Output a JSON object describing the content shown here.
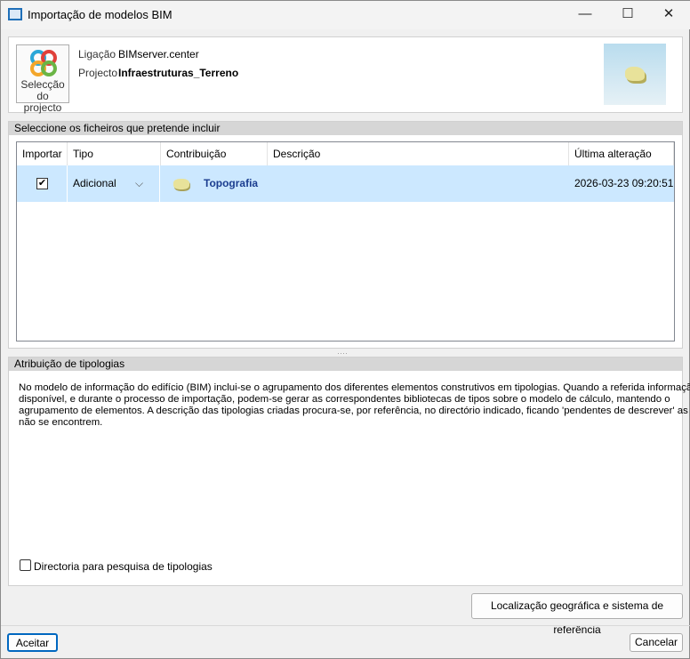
{
  "window": {
    "title": "Importação de modelos BIM",
    "minimize": "—",
    "maximize": "☐",
    "close": "✕"
  },
  "project": {
    "select_button": "Selecção do projecto",
    "connection_label": "Ligação",
    "connection_value": "BIMserver.center",
    "project_label": "Projecto",
    "project_value": "Infraestruturas_Terreno"
  },
  "files": {
    "section_title": "Seleccione os ficheiros que pretende incluir",
    "columns": [
      "Importar",
      "Tipo",
      "Contribuição",
      "Descrição",
      "Última alteração"
    ],
    "rows": [
      {
        "checked": true,
        "type": "Adicional",
        "contribution": "Topografia",
        "description": "",
        "modified": "2026-03-23 09:20:51"
      }
    ]
  },
  "typologies": {
    "section_title": "Atribuição de tipologias",
    "lines": [
      "No modelo de informação do edifício (BIM) inclui-se o agrupamento dos diferentes elementos construtivos em tipologias. Quando a referida informação está",
      "disponível, e durante o processo de importação, podem-se gerar as correspondentes bibliotecas de tipos sobre o modelo de cálculo, mantendo o",
      "agrupamento de elementos. A descrição das tipologias criadas procura-se, por referência, no directório indicado, ficando 'pendentes de descrever' as que",
      "não se encontrem."
    ],
    "directory_checkbox": "Directoria para pesquisa de tipologias",
    "directory_checked": false
  },
  "buttons": {
    "geo": "Localização geográfica e sistema de referência",
    "accept": "Aceitar",
    "cancel": "Cancelar"
  }
}
